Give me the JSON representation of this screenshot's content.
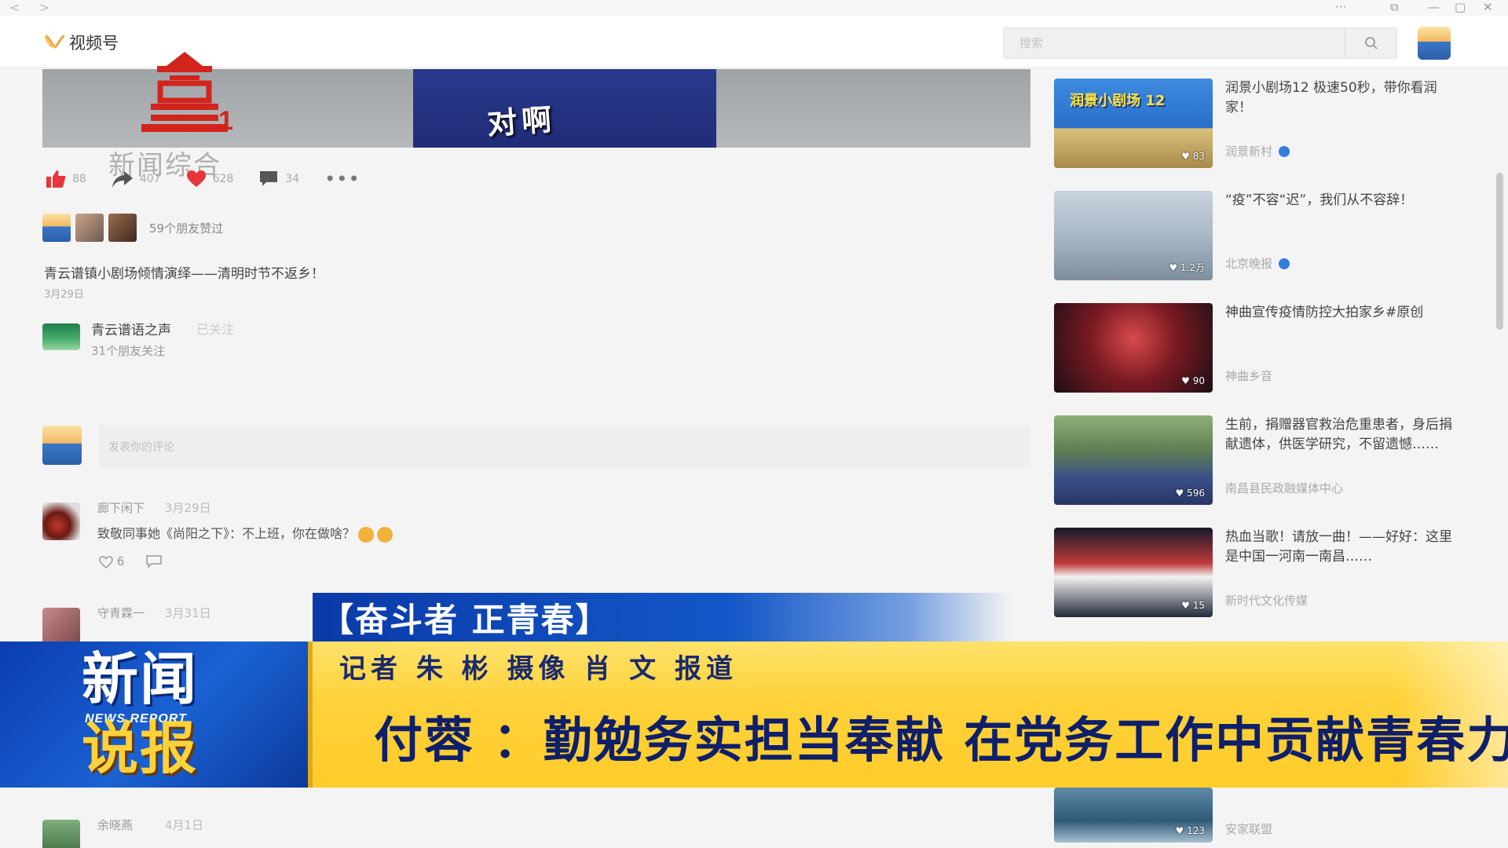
{
  "window": {
    "nav_back": "<",
    "nav_forward": ">",
    "controls": [
      "···",
      "⧉",
      "—",
      "▢",
      "✕"
    ]
  },
  "header": {
    "logo_text": "视频号",
    "search_placeholder": "搜索"
  },
  "video": {
    "subtitle": "对啊"
  },
  "station": {
    "number": "1",
    "sub_label": "新闻综合"
  },
  "actions": {
    "like_count": "88",
    "share_count": "407",
    "heart_count": "628",
    "comment_count": "34"
  },
  "friends": {
    "text": "59个朋友赞过"
  },
  "post": {
    "description": "青云谱镇小剧场倾情演绎——清明时节不返乡！",
    "date": "3月29日"
  },
  "author": {
    "name": "青云谱语之声",
    "follow_label": "已关注",
    "meta": "31个朋友关注"
  },
  "comment_input": {
    "placeholder": "发表你的评论"
  },
  "comments": [
    {
      "name": "廊下闲下",
      "date": "3月29日",
      "text": "致敬同事她《尚阳之下》：不上班，你在做啥？",
      "likes": "6"
    },
    {
      "name": "守青霖一",
      "date": "3月31日",
      "text": ""
    },
    {
      "name": "余晓燕",
      "date": "4月1日",
      "text": ""
    }
  ],
  "recommendations": [
    {
      "title": "润景小剧场12 极速50秒，带你看润家！",
      "author": "润景新村",
      "verified": true,
      "badge": "♥ 83",
      "thumb_text": "润景小剧场 12"
    },
    {
      "title": "“疫”不容“迟”，我们从不容辞！",
      "author": "北京晚报",
      "verified": true,
      "badge": "♥ 1.2万"
    },
    {
      "title": "神曲宣传疫情防控大拍家乡#原创",
      "author": "神曲乡音",
      "verified": false,
      "badge": "♥ 90"
    },
    {
      "title": "生前，捐赠器官救治危重患者，身后捐献遗体，供医学研究，不留遗憾……",
      "author": "南昌县民政融媒体中心",
      "verified": false,
      "badge": "♥ 596"
    },
    {
      "title": "热血当歌！请放一曲！——好好：这里是中国一河南一南昌……",
      "author": "新时代文化传媒",
      "verified": false,
      "badge": "♥ 15"
    },
    {
      "title": "",
      "author": "安家联盟",
      "verified": false,
      "badge": "♥ 123"
    }
  ],
  "overlay": {
    "segment": "【奋斗者 正青春】",
    "credit": "记者 朱 彬 摄像 肖 文 报道",
    "headline": "付蓉 ：勤勉务实担当奉献 在党务工作中贡献青春力量",
    "program_line1": "新闻",
    "program_en": "NEWS REPORT",
    "program_line2": "说报"
  },
  "colors": {
    "accent_blue": "#1457c8",
    "strap_yellow": "#ffd23a",
    "station_red": "#d3241c",
    "like_red": "#e8353a"
  }
}
